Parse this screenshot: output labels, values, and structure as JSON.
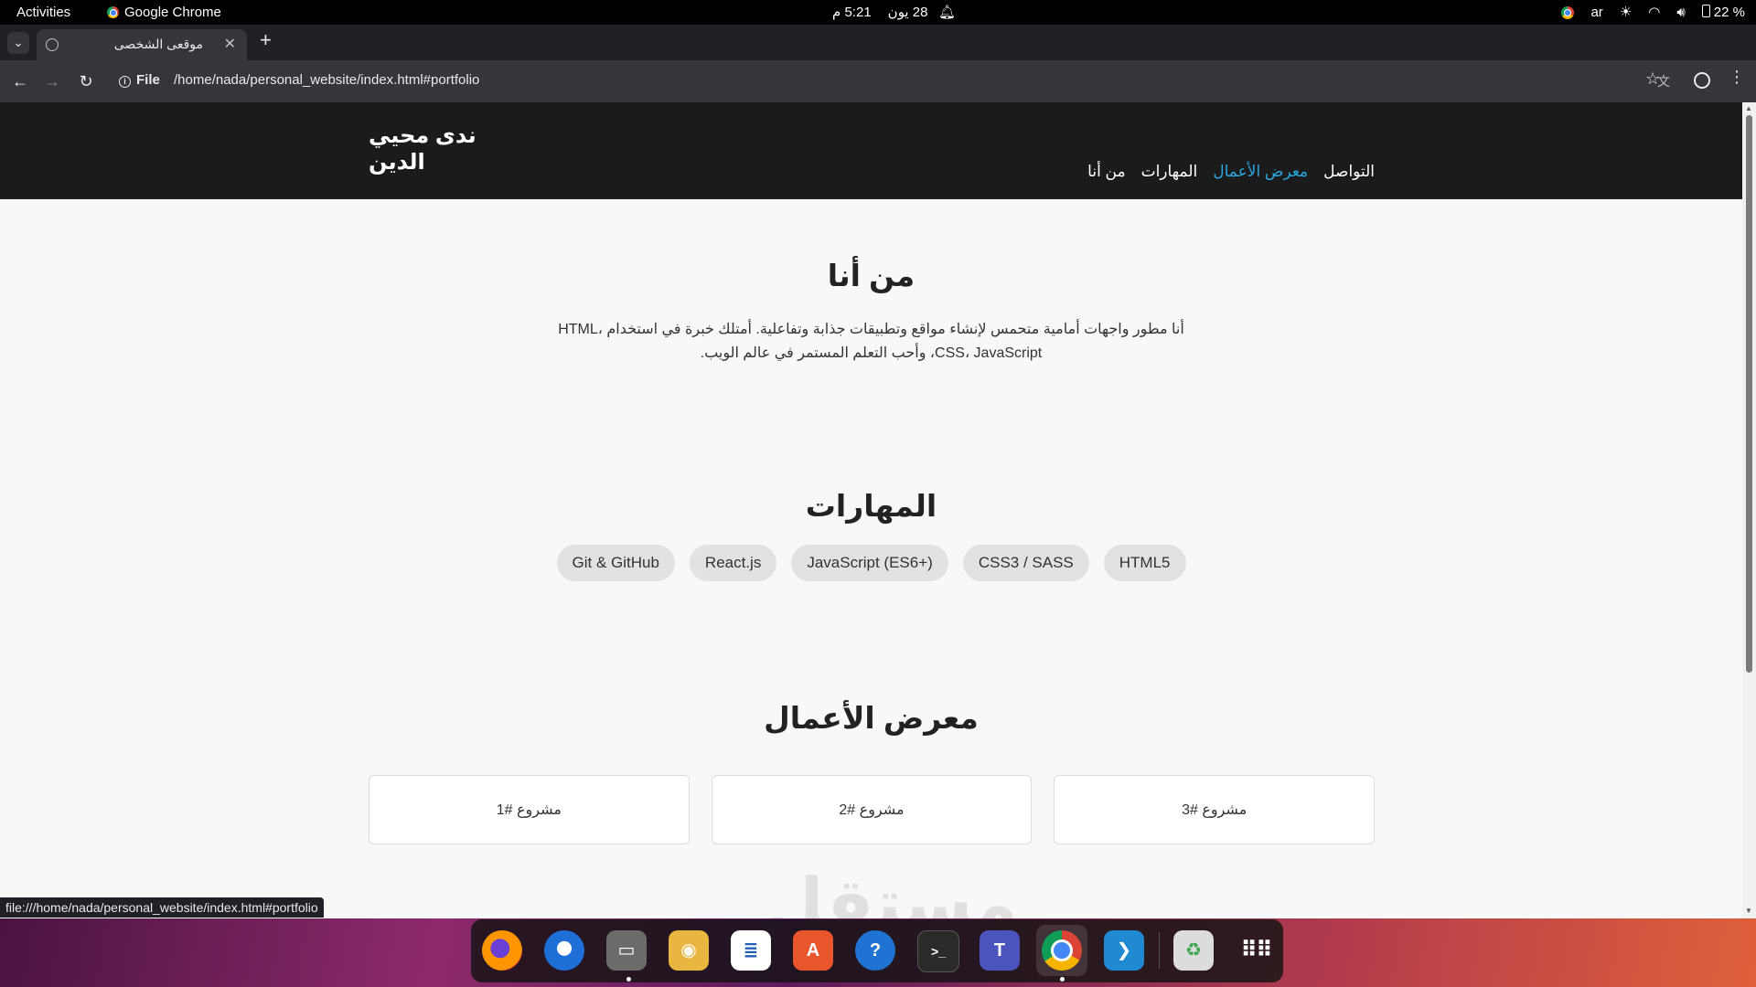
{
  "system_bar": {
    "activities": "Activities",
    "app_name": "Google Chrome",
    "date": "28 يون",
    "time": "5:21 م",
    "language": "ar",
    "battery": "22 %"
  },
  "browser": {
    "tab_title": "موقعى الشخصى",
    "new_tab": "+",
    "scheme_label": "File",
    "url": "/home/nada/personal_website/index.html#portfolio",
    "status_url": "file:///home/nada/personal_website/index.html#portfolio"
  },
  "site": {
    "name": "ندى محيي الدين",
    "nav": [
      "التواصل",
      "معرض الأعمال",
      "المهارات",
      "من أنا"
    ],
    "active_nav": "معرض الأعمال",
    "accent_color": "#29a8e0",
    "about": {
      "title": "من أنا",
      "text": "أنا مطور واجهات أمامية متحمس لإنشاء مواقع وتطبيقات جذابة وتفاعلية. أمتلك خبرة في استخدام HTML، CSS، JavaScript، وأحب التعلم المستمر في عالم الويب."
    },
    "skills": {
      "title": "المهارات",
      "items": [
        "HTML5",
        "CSS3 / SASS",
        "JavaScript (ES6+)",
        "React.js",
        "Git & GitHub"
      ]
    },
    "portfolio": {
      "title": "معرض الأعمال",
      "projects": [
        "مشروع #1",
        "مشروع #2",
        "مشروع #3"
      ]
    }
  },
  "watermark": "مستقل",
  "dock": {
    "apps": [
      "firefox-icon",
      "thunderbird-icon",
      "files-icon",
      "rhythmbox-icon",
      "writer-icon",
      "app-center-icon",
      "help-icon",
      "terminal-icon",
      "teams-icon",
      "chrome-icon",
      "vscode-icon",
      "trash-icon",
      "show-apps-icon"
    ],
    "terminal_glyph": ">_"
  }
}
